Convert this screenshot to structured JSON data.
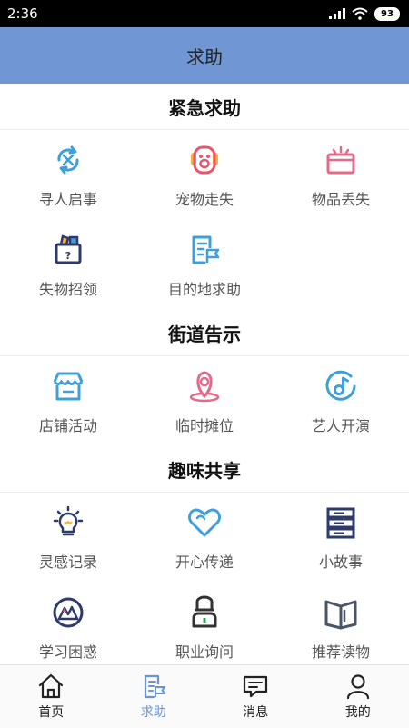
{
  "status_bar": {
    "time": "2:36",
    "battery": "93"
  },
  "header": {
    "title": "求助"
  },
  "sections": [
    {
      "title": "紧急求助",
      "items": [
        {
          "label": "寻人启事",
          "icon": "search-person-icon"
        },
        {
          "label": "宠物走失",
          "icon": "pet-icon"
        },
        {
          "label": "物品丢失",
          "icon": "box-icon"
        },
        {
          "label": "失物招领",
          "icon": "lost-found-icon"
        },
        {
          "label": "目的地求助",
          "icon": "destination-flag-icon"
        }
      ]
    },
    {
      "title": "街道告示",
      "items": [
        {
          "label": "店铺活动",
          "icon": "shop-icon"
        },
        {
          "label": "临时摊位",
          "icon": "location-pin-icon"
        },
        {
          "label": "艺人开演",
          "icon": "music-note-icon"
        }
      ]
    },
    {
      "title": "趣味共享",
      "items": [
        {
          "label": "灵感记录",
          "icon": "lightbulb-icon"
        },
        {
          "label": "开心传递",
          "icon": "heart-icon"
        },
        {
          "label": "小故事",
          "icon": "books-icon"
        },
        {
          "label": "学习困惑",
          "icon": "mountain-icon"
        },
        {
          "label": "职业询问",
          "icon": "worker-icon"
        },
        {
          "label": "推荐读物",
          "icon": "open-book-icon"
        }
      ]
    }
  ],
  "bottom_nav": {
    "active": "求助",
    "items": [
      {
        "label": "首页",
        "icon": "home-icon"
      },
      {
        "label": "求助",
        "icon": "help-doc-icon"
      },
      {
        "label": "消息",
        "icon": "message-icon"
      },
      {
        "label": "我的",
        "icon": "profile-icon"
      }
    ]
  },
  "colors": {
    "title_bar": "#7097d4",
    "accent_blue": "#3fa0d8",
    "accent_pink": "#e36a8a",
    "dark_navy": "#2e3a6b",
    "active_nav": "#6d94d2"
  }
}
